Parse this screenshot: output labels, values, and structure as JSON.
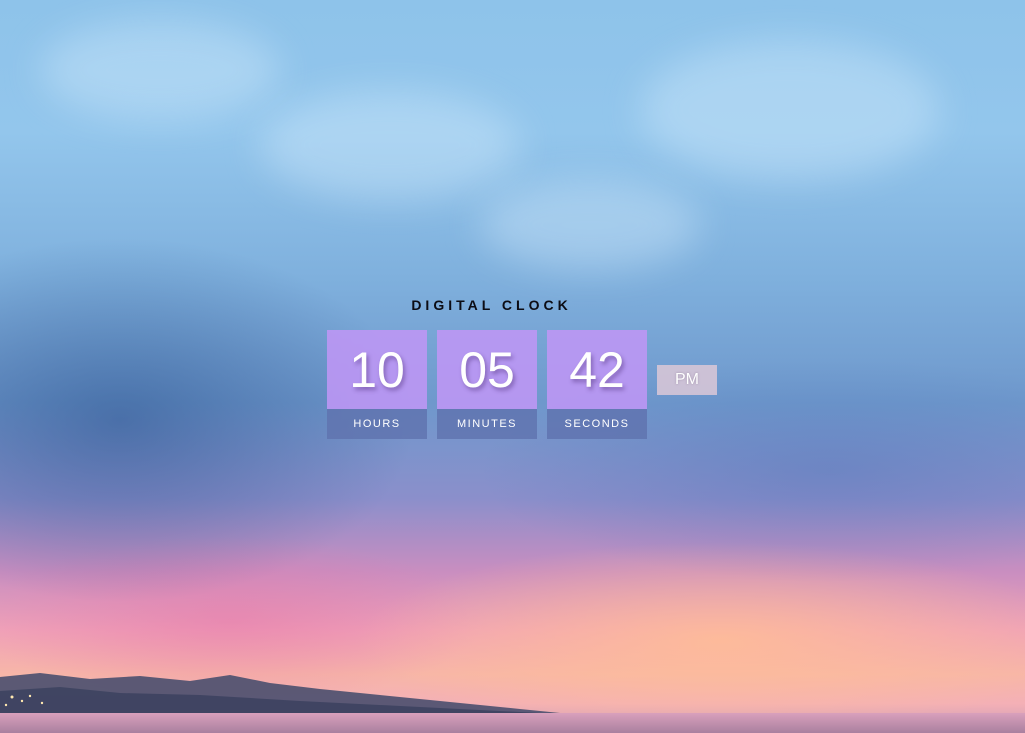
{
  "title": "DIGITAL CLOCK",
  "clock": {
    "hours": "10",
    "minutes": "05",
    "seconds": "42",
    "period": "PM"
  },
  "labels": {
    "hours": "HOURS",
    "minutes": "MINUTES",
    "seconds": "SECONDS"
  },
  "colors": {
    "digit_box": "#be96f5",
    "label_bar": "#5f73af",
    "period_badge": "#dcc8d7",
    "title_text": "#0c0c14"
  }
}
